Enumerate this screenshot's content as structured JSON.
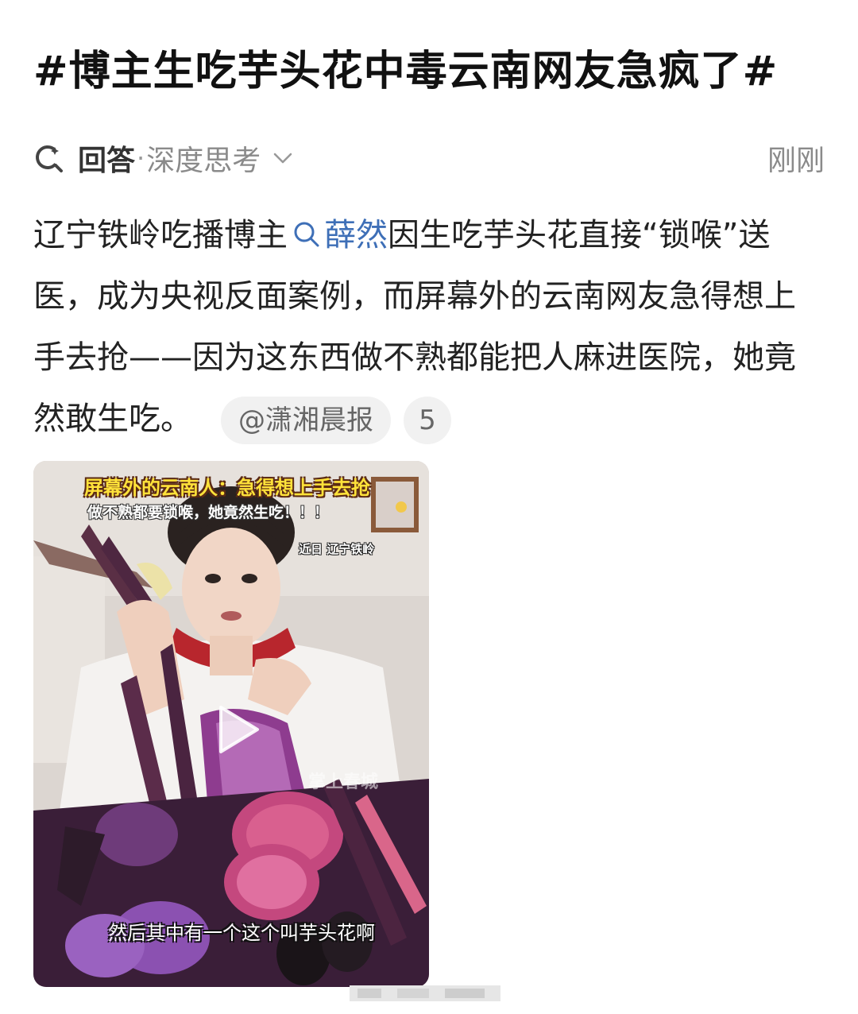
{
  "post": {
    "title": "#博主生吃芋头花中毒云南网友急疯了#"
  },
  "meta": {
    "answer_label": "回答",
    "dot": "·",
    "mode_label": "深度思考",
    "time": "刚刚",
    "icons": {
      "answer": "search-sparkle-icon",
      "expand": "chevron-down-icon"
    }
  },
  "body": {
    "text_before": "辽宁铁岭吃播博主",
    "search_term": "薛然",
    "text_after": "因生吃芋头花直接“锁喉”送医，成为央视反面案例，而屏幕外的云南网友急得想上手去抢——因为这东西做不熟都能把人麻进医院，她竟然敢生吃。",
    "source_chip": "@潇湘晨报",
    "source_count": "5"
  },
  "video": {
    "caption_top_yellow": "屏幕外的云南人：急得想上手去抢",
    "caption_top_white": "做不熟都要锁喉，她竟然生吃！！！",
    "caption_date": "近日 辽宁铁岭",
    "caption_bottom": "然后其中有一个这个叫芋头花啊",
    "watermark": "掌上春城",
    "play_icon": "play-icon"
  },
  "colors": {
    "link": "#3e6fb7",
    "muted": "#8a8a8a",
    "chip_bg": "#f1f1f1"
  }
}
